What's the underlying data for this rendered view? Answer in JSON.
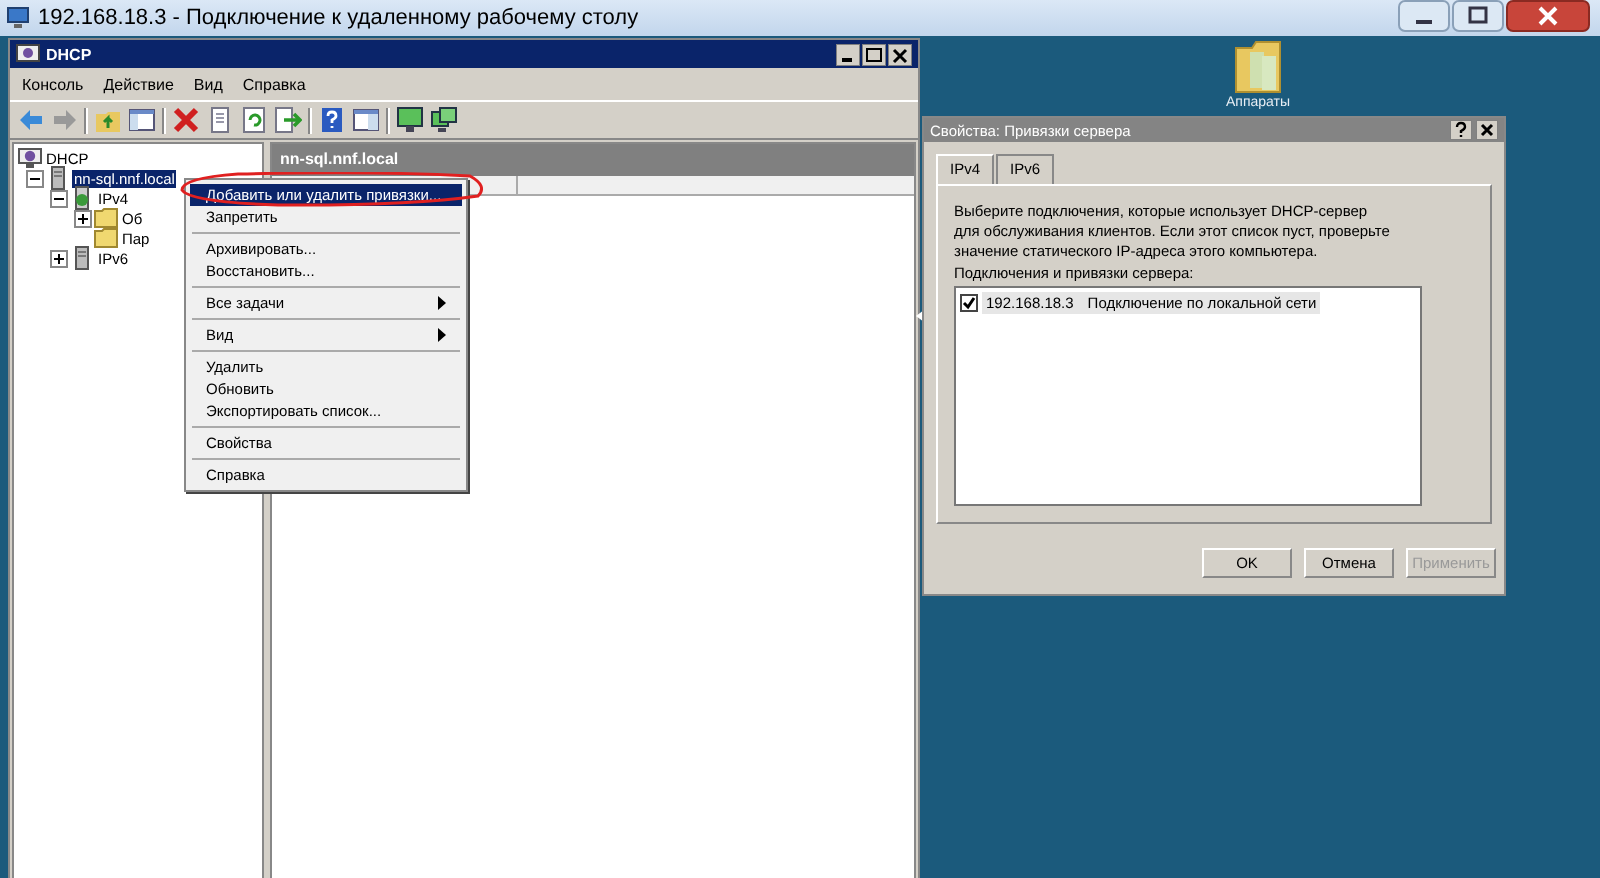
{
  "window": {
    "title": "192.168.18.3 - Подключение к удаленному рабочему столу"
  },
  "desktop_icons": [
    {
      "label": "Аппараты"
    }
  ],
  "mmc": {
    "title": "DHCP",
    "menu": [
      "Консоль",
      "Действие",
      "Вид",
      "Справка"
    ],
    "tree": [
      {
        "label": "DHCP",
        "kind": "dhcp",
        "selected": false,
        "children": [
          {
            "label": "nn-sql.nnf.local",
            "kind": "server",
            "selected": true,
            "expanded": true,
            "children": [
              {
                "label": "IPv4",
                "kind": "ipv4",
                "selected": false,
                "expanded": true,
                "children": [
                  {
                    "label": "Об",
                    "kind": "folder",
                    "selected": false,
                    "expanded": false
                  },
                  {
                    "label": "Пар",
                    "kind": "folder",
                    "selected": false
                  }
                ]
              },
              {
                "label": "IPv6",
                "kind": "server",
                "selected": false,
                "expanded": false
              }
            ]
          }
        ]
      }
    ],
    "pane_title": "nn-sql.nnf.local"
  },
  "context_menu": {
    "groups": [
      [
        {
          "label": "Добавить или удалить привязки...",
          "selected": true,
          "submenu": false
        },
        {
          "label": "Запретить",
          "selected": false,
          "submenu": false
        }
      ],
      [
        {
          "label": "Архивировать...",
          "selected": false,
          "submenu": false
        },
        {
          "label": "Восстановить...",
          "selected": false,
          "submenu": false
        }
      ],
      [
        {
          "label": "Все задачи",
          "selected": false,
          "submenu": true
        }
      ],
      [
        {
          "label": "Вид",
          "selected": false,
          "submenu": true
        }
      ],
      [
        {
          "label": "Удалить",
          "selected": false,
          "submenu": false
        },
        {
          "label": "Обновить",
          "selected": false,
          "submenu": false
        },
        {
          "label": "Экспортировать список...",
          "selected": false,
          "submenu": false
        }
      ],
      [
        {
          "label": "Свойства",
          "selected": false,
          "submenu": false
        }
      ],
      [
        {
          "label": "Справка",
          "selected": false,
          "submenu": false
        }
      ]
    ]
  },
  "dialog": {
    "title": "Свойства: Привязки сервера",
    "tabs": [
      {
        "label": "IPv4",
        "selected": true
      },
      {
        "label": "IPv6",
        "selected": false
      }
    ],
    "description": "Выберите подключения, которые использует DHCP-сервер для обслуживания клиентов. Если этот список пуст, проверьте значение статического IP-адреса этого компьютера.",
    "list_label": "Подключения и привязки сервера:",
    "bindings": [
      {
        "ip": "192.168.18.3",
        "name": "Подключение по локальной сети",
        "checked": true
      }
    ],
    "buttons": [
      {
        "label": "OK",
        "disabled": false
      },
      {
        "label": "Отмена",
        "disabled": false
      },
      {
        "label": "Применить",
        "disabled": true
      }
    ]
  }
}
